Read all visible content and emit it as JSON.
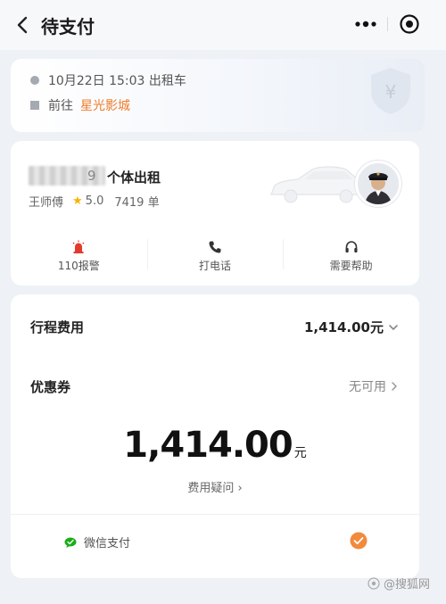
{
  "header": {
    "title": "待支付"
  },
  "trip": {
    "datetime": "10月22日 15:03 出租车",
    "destination_prefix": "前往",
    "destination": "星光影城"
  },
  "driver": {
    "plate_visible_tail": "9",
    "car_type": "个体出租",
    "name": "王师傅",
    "rating": "5.0",
    "orders": "7419 单"
  },
  "actions": [
    {
      "label": "110报警",
      "icon": "siren-icon",
      "color": "#e23b2e"
    },
    {
      "label": "打电话",
      "icon": "phone-icon",
      "color": "#333333"
    },
    {
      "label": "需要帮助",
      "icon": "headset-icon",
      "color": "#333333"
    }
  ],
  "payment": {
    "fee_label": "行程费用",
    "fee_value": "1,414.00元",
    "coupon_label": "优惠券",
    "coupon_value": "无可用",
    "total_amount": "1,414.00",
    "total_unit": "元",
    "doubt_label": "费用疑问 ›",
    "method_label": "微信支付",
    "accent_color": "#f28a3c",
    "wechat_color": "#1aad19"
  },
  "watermark": {
    "text": "@搜狐网"
  }
}
